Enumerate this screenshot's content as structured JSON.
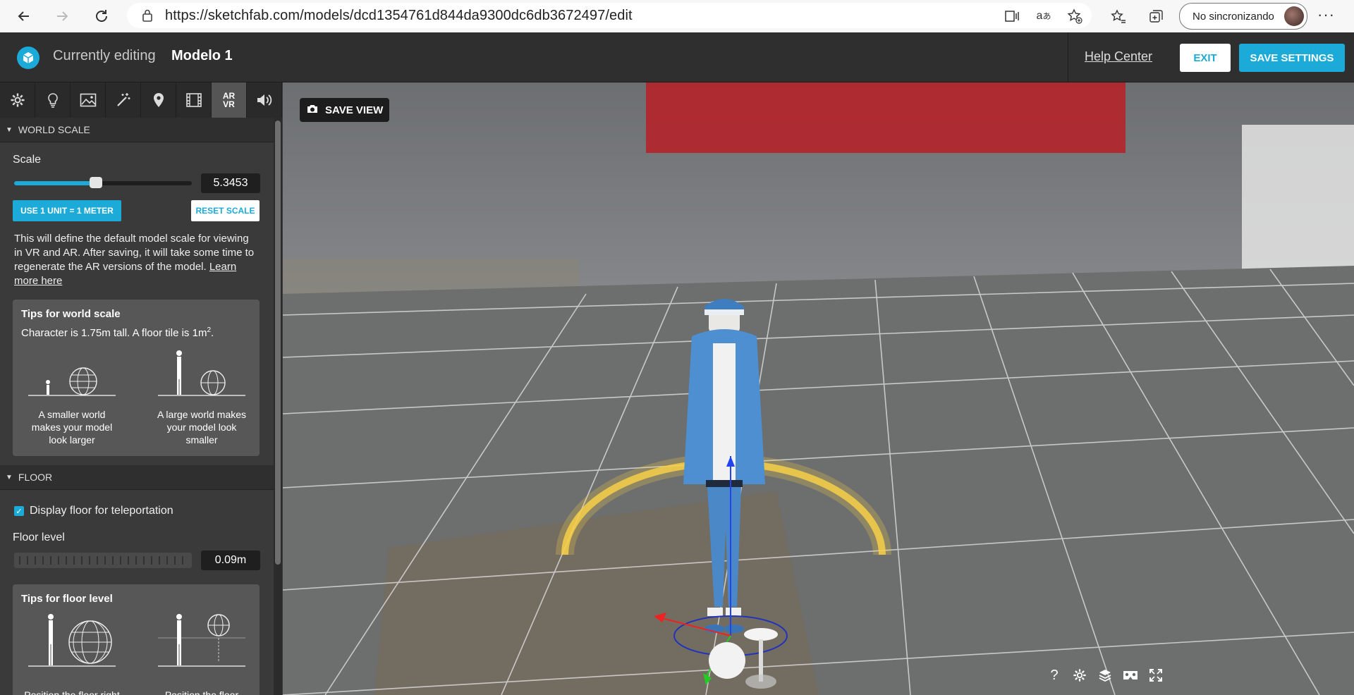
{
  "browser": {
    "url": "https://sketchfab.com/models/dcd1354761d844da9300dc6db3672497/edit",
    "profile_label": "No sincronizando",
    "back_icon": "arrow-left-icon",
    "forward_icon": "arrow-right-icon",
    "reload_icon": "reload-icon"
  },
  "header": {
    "editing_label": "Currently editing",
    "model_name": "Modelo 1",
    "help_label": "Help Center",
    "exit_label": "EXIT",
    "save_label": "SAVE SETTINGS"
  },
  "toolbar": {
    "tools": [
      "gear-icon",
      "lightbulb-icon",
      "image-icon",
      "magic-wand-icon",
      "map-pin-icon",
      "film-icon",
      "ar-vr-icon",
      "speaker-icon"
    ],
    "ar_line1": "AR",
    "ar_line2": "VR",
    "active": "ar-vr-icon"
  },
  "world_scale": {
    "section_title": "WORLD SCALE",
    "scale_label": "Scale",
    "scale_value": "5.3453",
    "slider_fraction": 0.46,
    "unit_button": "USE 1 UNIT = 1 METER",
    "reset_button": "RESET SCALE",
    "desc": "This will define the default model scale for viewing in VR and AR. After saving, it will take some time to regenerate the AR versions of the model.",
    "learn_more": "Learn more here",
    "tips_title": "Tips for world scale",
    "tips_sub": "Character is 1.75m tall. A floor tile is 1m",
    "tips_sup": "2",
    "tips_sub_end": ".",
    "caption_small": "A smaller world makes your model look larger",
    "caption_large": "A large world makes your model look smaller"
  },
  "floor": {
    "section_title": "FLOOR",
    "display_label": "Display floor for teleportation",
    "display_checked": true,
    "level_label": "Floor level",
    "level_value": "0.09m",
    "tips_title": "Tips for floor level",
    "caption_left": "Position the floor right below large",
    "caption_right": "Position the floor further down for"
  },
  "viewer": {
    "save_view_label": "SAVE VIEW",
    "bottom_icons": [
      "help-icon",
      "gear-icon",
      "layers-icon",
      "vr-headset-icon",
      "fullscreen-icon"
    ],
    "help_glyph": "?"
  },
  "colors": {
    "accent": "#1caad9",
    "header_bg": "#2f2f2f",
    "sidebar_bg": "#3a3a3a",
    "tips_bg": "#575757"
  }
}
